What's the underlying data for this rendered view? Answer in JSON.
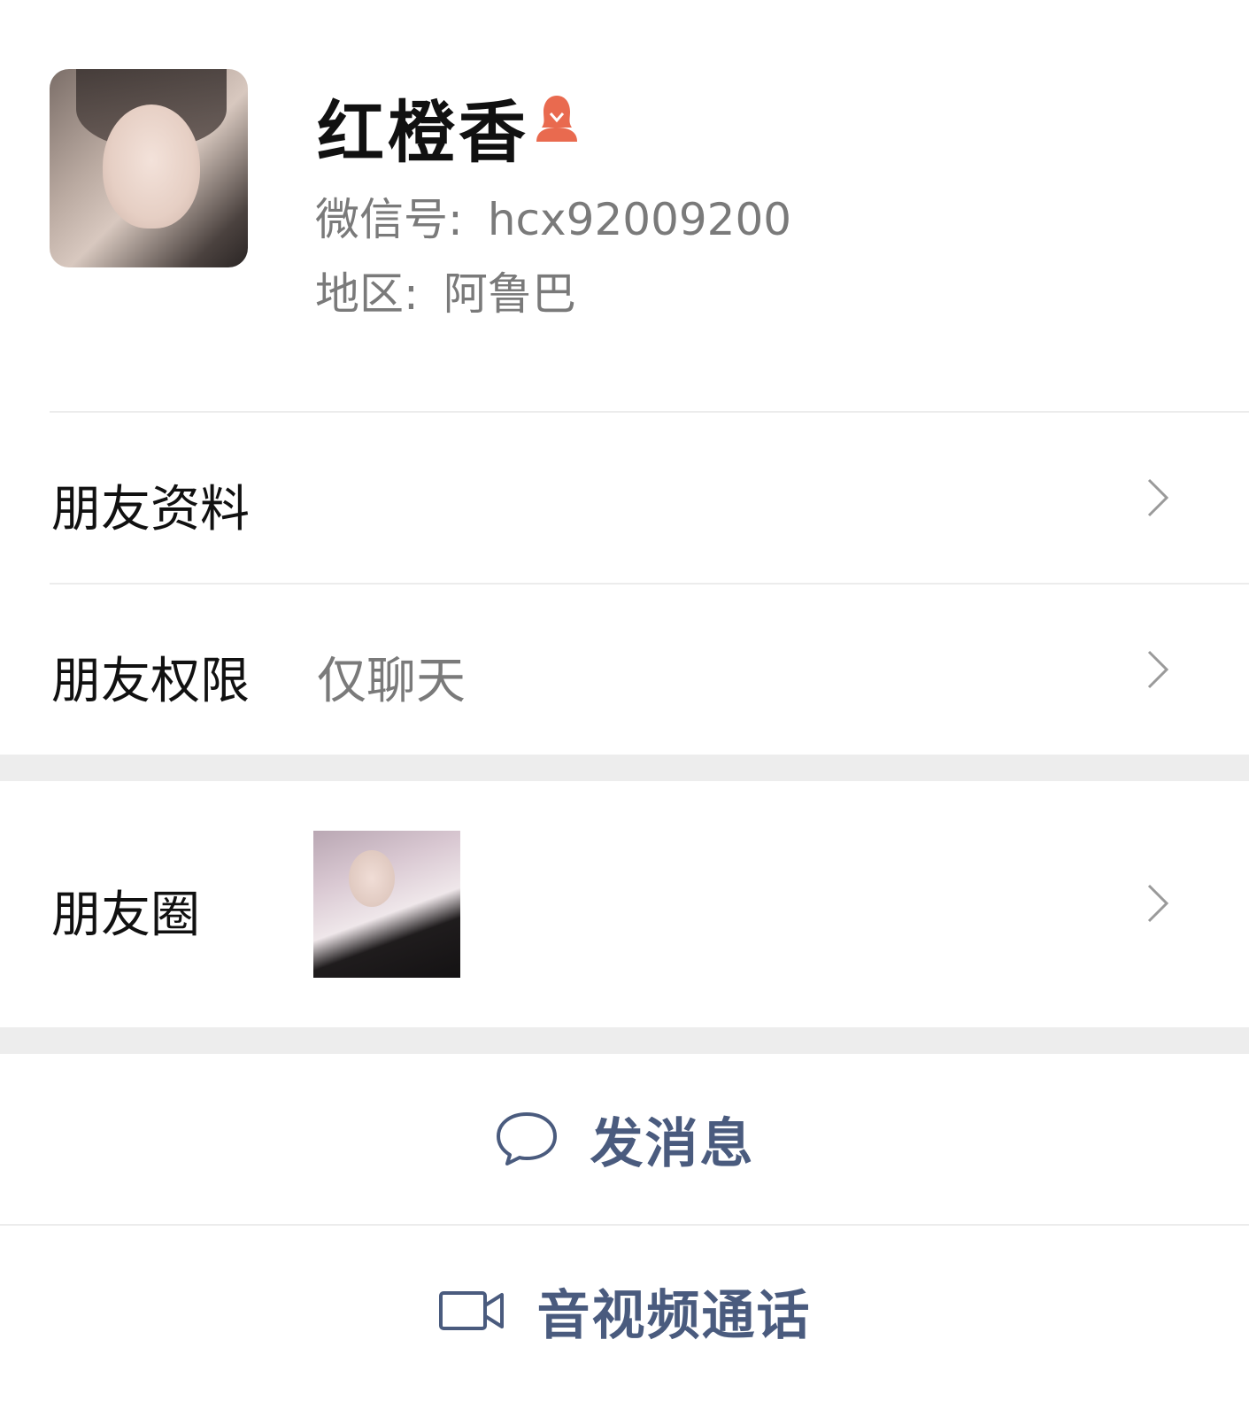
{
  "profile": {
    "name": "红橙香",
    "gender_icon": "female-icon",
    "wechat_id_label": "微信号:",
    "wechat_id": "hcx92009200",
    "region_label": "地区:",
    "region": "阿鲁巴"
  },
  "rows": {
    "friend_info": {
      "label": "朋友资料"
    },
    "friend_permission": {
      "label": "朋友权限",
      "value": "仅聊天"
    },
    "moments": {
      "label": "朋友圈"
    }
  },
  "actions": {
    "message": {
      "label": "发消息",
      "icon": "chat-bubble-icon"
    },
    "video_call": {
      "label": "音视频通话",
      "icon": "video-camera-icon"
    }
  },
  "colors": {
    "accent": "#4a5b7e",
    "secondary_text": "#7a7a7a",
    "gender_icon": "#e96a4f",
    "separator": "#ededed"
  }
}
